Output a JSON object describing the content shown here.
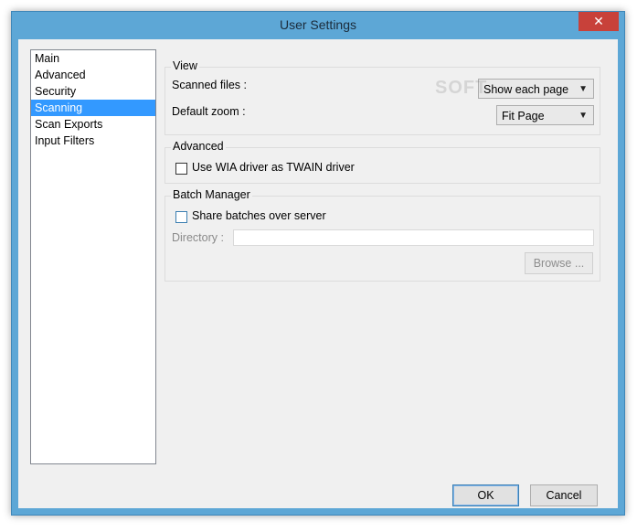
{
  "window": {
    "title": "User Settings",
    "close_glyph": "✕"
  },
  "nav": {
    "items": [
      {
        "label": "Main",
        "selected": false
      },
      {
        "label": "Advanced",
        "selected": false
      },
      {
        "label": "Security",
        "selected": false
      },
      {
        "label": "Scanning",
        "selected": true
      },
      {
        "label": "Scan Exports",
        "selected": false
      },
      {
        "label": "Input Filters",
        "selected": false
      }
    ]
  },
  "view": {
    "title": "View",
    "scanned_files_label": "Scanned files :",
    "scanned_files_value": "Show each page",
    "default_zoom_label": "Default zoom :",
    "default_zoom_value": "Fit Page"
  },
  "advanced": {
    "title": "Advanced",
    "wia_checkbox_label": "Use WIA driver as TWAIN driver",
    "wia_checked": false
  },
  "batch": {
    "title": "Batch Manager",
    "share_checkbox_label": "Share batches over server",
    "share_checked": false,
    "directory_label": "Directory :",
    "directory_value": "",
    "browse_label": "Browse ..."
  },
  "footer": {
    "ok_label": "OK",
    "cancel_label": "Cancel"
  },
  "colors": {
    "accent": "#3399ff",
    "frame": "#5da7d6",
    "close": "#c8413a"
  }
}
